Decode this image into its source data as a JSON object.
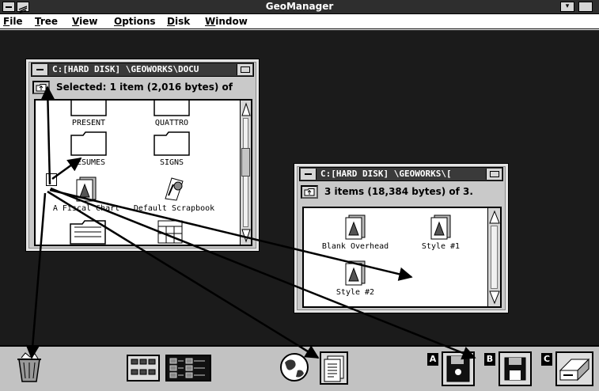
{
  "app": {
    "title": "GeoManager"
  },
  "menu": [
    {
      "u": "F",
      "rest": "ile"
    },
    {
      "u": "T",
      "rest": "ree"
    },
    {
      "u": "V",
      "rest": "iew"
    },
    {
      "u": "O",
      "rest": "ptions"
    },
    {
      "u": "D",
      "rest": "isk"
    },
    {
      "u": "W",
      "rest": "indow"
    }
  ],
  "window_left": {
    "title": "C:[HARD DISK] \\GEOWORKS\\DOCU",
    "status": "Selected: 1 item (2,016 bytes) of",
    "items": {
      "present": "PRESENT",
      "quattro": "QUATTRO",
      "resumes": "RESUMES",
      "signs": "SIGNS",
      "fiscal": "A Fiscal Chart",
      "scrapbook": "Default Scrapbook"
    }
  },
  "window_right": {
    "title": "C:[HARD DISK] \\GEOWORKS\\[",
    "status": "3 items (18,384 bytes) of 3.",
    "items": {
      "blank": "Blank Overhead",
      "style1": "Style #1",
      "style2": "Style #2"
    }
  },
  "taskbar": {
    "drive_a": "A",
    "drive_b": "B",
    "drive_c": "C"
  },
  "colors": {
    "desktop": "#1b1b1b",
    "titlebar": "#2e2e2e",
    "window_face": "#c9c9c9",
    "taskbar": "#c2c2c2"
  }
}
